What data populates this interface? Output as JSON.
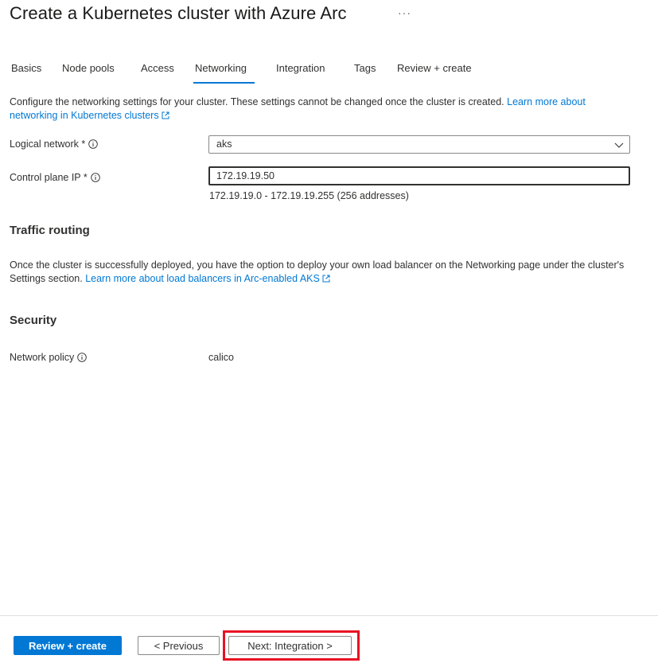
{
  "header": {
    "title": "Create a Kubernetes cluster with Azure Arc",
    "more_label": "···"
  },
  "tabs": [
    {
      "label": "Basics",
      "active": false
    },
    {
      "label": "Node pools",
      "active": false
    },
    {
      "label": "Access",
      "active": false
    },
    {
      "label": "Networking",
      "active": true
    },
    {
      "label": "Integration",
      "active": false
    },
    {
      "label": "Tags",
      "active": false
    },
    {
      "label": "Review + create",
      "active": false
    }
  ],
  "intro": {
    "text": "Configure the networking settings for your cluster. These settings cannot be changed once the cluster is created. ",
    "link": "Learn more about networking in Kubernetes clusters"
  },
  "form": {
    "logical_network": {
      "label": "Logical network *",
      "value": "aks"
    },
    "control_plane_ip": {
      "label": "Control plane IP *",
      "value": "172.19.19.50",
      "hint": "172.19.19.0 - 172.19.19.255 (256 addresses)"
    }
  },
  "traffic_routing": {
    "heading": "Traffic routing",
    "text": "Once the cluster is successfully deployed, you have the option to deploy your own load balancer on the Networking page under the cluster's Settings section. ",
    "link": "Learn more about load balancers in Arc-enabled AKS"
  },
  "security": {
    "heading": "Security",
    "network_policy_label": "Network policy",
    "network_policy_value": "calico"
  },
  "footer": {
    "review_create": "Review + create",
    "previous": "< Previous",
    "next": "Next: Integration >"
  },
  "colors": {
    "accent": "#0078d4",
    "highlight": "#e81123"
  }
}
